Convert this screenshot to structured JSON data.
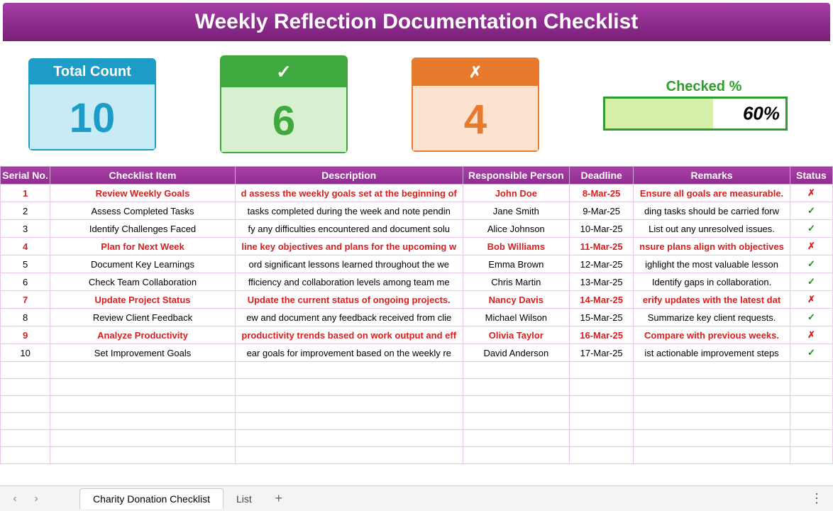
{
  "title": "Weekly Reflection Documentation Checklist",
  "cards": {
    "total": {
      "label": "Total Count",
      "value": "10"
    },
    "checked": {
      "label": "✓",
      "value": "6"
    },
    "unchecked": {
      "label": "✗",
      "value": "4"
    }
  },
  "progress": {
    "label": "Checked %",
    "value": "60%",
    "fill": 60
  },
  "columns": [
    "Serial No.",
    "Checklist Item",
    "Description",
    "Responsible Person",
    "Deadline",
    "Remarks",
    "Status"
  ],
  "rows": [
    {
      "serial": "1",
      "item": "Review Weekly Goals",
      "desc": "d assess the weekly goals set at the beginning of",
      "person": "John Doe",
      "deadline": "8-Mar-25",
      "remarks": "Ensure all goals are measurable.",
      "status": "✗",
      "checked": false
    },
    {
      "serial": "2",
      "item": "Assess Completed Tasks",
      "desc": "tasks completed during the week and note pendin",
      "person": "Jane Smith",
      "deadline": "9-Mar-25",
      "remarks": "ding tasks should be carried forw",
      "status": "✓",
      "checked": true
    },
    {
      "serial": "3",
      "item": "Identify Challenges Faced",
      "desc": "fy any difficulties encountered and document solu",
      "person": "Alice Johnson",
      "deadline": "10-Mar-25",
      "remarks": "List out any unresolved issues.",
      "status": "✓",
      "checked": true
    },
    {
      "serial": "4",
      "item": "Plan for Next Week",
      "desc": "line key objectives and plans for the upcoming w",
      "person": "Bob Williams",
      "deadline": "11-Mar-25",
      "remarks": "nsure plans align with objectives",
      "status": "✗",
      "checked": false
    },
    {
      "serial": "5",
      "item": "Document Key Learnings",
      "desc": "ord significant lessons learned throughout the we",
      "person": "Emma Brown",
      "deadline": "12-Mar-25",
      "remarks": "ighlight the most valuable lesson",
      "status": "✓",
      "checked": true
    },
    {
      "serial": "6",
      "item": "Check Team Collaboration",
      "desc": "fficiency and collaboration levels among team me",
      "person": "Chris Martin",
      "deadline": "13-Mar-25",
      "remarks": "Identify gaps in collaboration.",
      "status": "✓",
      "checked": true
    },
    {
      "serial": "7",
      "item": "Update Project Status",
      "desc": "Update the current status of ongoing projects.",
      "person": "Nancy Davis",
      "deadline": "14-Mar-25",
      "remarks": "erify updates with the latest dat",
      "status": "✗",
      "checked": false
    },
    {
      "serial": "8",
      "item": "Review Client Feedback",
      "desc": "ew and document any feedback received from clie",
      "person": "Michael Wilson",
      "deadline": "15-Mar-25",
      "remarks": "Summarize key client requests.",
      "status": "✓",
      "checked": true
    },
    {
      "serial": "9",
      "item": "Analyze Productivity",
      "desc": "productivity trends based on work output and eff",
      "person": "Olivia Taylor",
      "deadline": "16-Mar-25",
      "remarks": "Compare with previous weeks.",
      "status": "✗",
      "checked": false
    },
    {
      "serial": "10",
      "item": "Set Improvement Goals",
      "desc": "ear goals for improvement based on the weekly re",
      "person": "David Anderson",
      "deadline": "17-Mar-25",
      "remarks": "ist actionable improvement steps",
      "status": "✓",
      "checked": true
    }
  ],
  "empty_rows": 6,
  "footer": {
    "tabs": [
      "Charity Donation Checklist",
      "List"
    ],
    "active_tab": 0
  }
}
